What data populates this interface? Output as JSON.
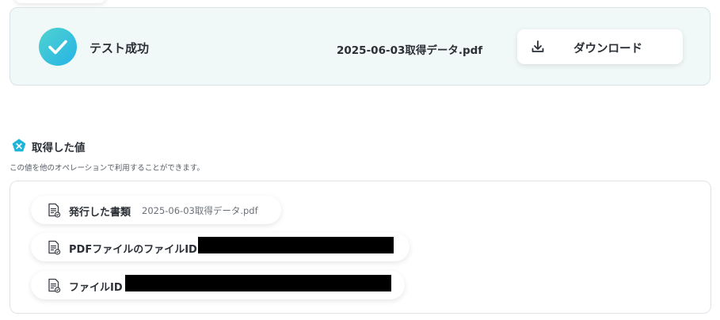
{
  "result": {
    "status_text": "テスト成功",
    "file_name": "2025-06-03取得データ.pdf",
    "download_label": "ダウンロード"
  },
  "section": {
    "title": "取得した値",
    "description": "この値を他のオペレーションで利用することができます。"
  },
  "values": [
    {
      "label": "発行した書類",
      "value": "2025-06-03取得データ.pdf",
      "icon": "document-icon"
    },
    {
      "label": "PDFファイルのファイルID",
      "value": "",
      "redacted": true,
      "icon": "document-icon"
    },
    {
      "label": "ファイルID",
      "value": "",
      "redacted": true,
      "icon": "document-icon"
    }
  ],
  "colors": {
    "accent_start": "#4fd3cf",
    "accent_end": "#26b3e6",
    "panel_bg": "#f0f8f8",
    "section_icon": "#1fb5d8"
  }
}
